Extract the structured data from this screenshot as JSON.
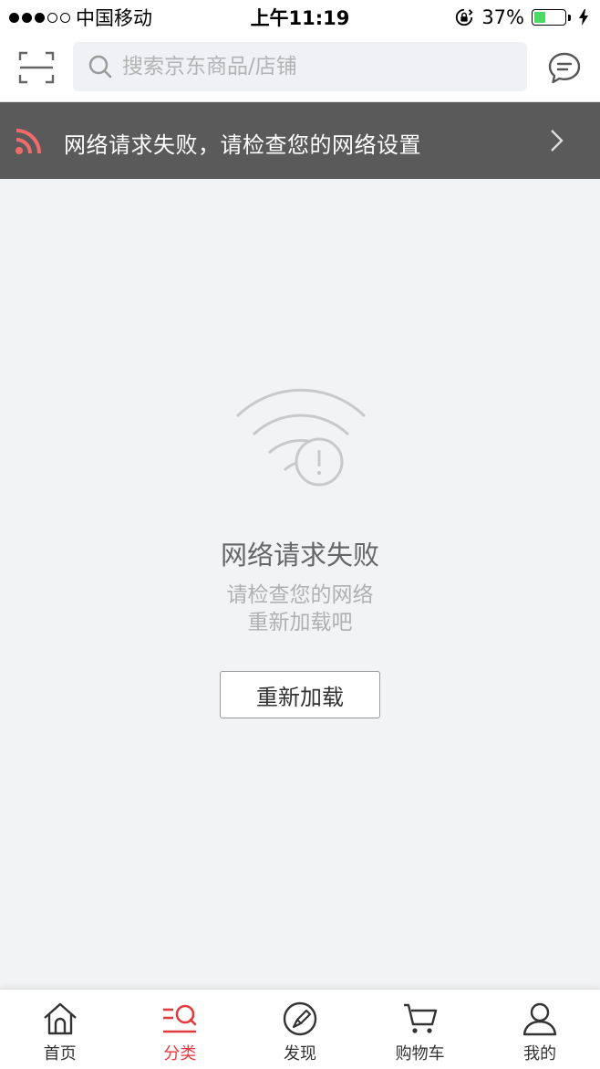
{
  "status_bar": {
    "carrier": "中国移动",
    "time": "上午11:19",
    "battery_percent": "37%",
    "battery_level": 0.37,
    "signal_bars": 3
  },
  "header": {
    "search_placeholder": "搜索京东商品/店铺",
    "scan_icon": "scan-icon",
    "message_icon": "message-icon"
  },
  "banner": {
    "text": "网络请求失败，请检查您的网络设置",
    "icon": "rss-icon"
  },
  "error": {
    "title": "网络请求失败",
    "line1": "请检查您的网络",
    "line2": "重新加载吧",
    "reload_label": "重新加载"
  },
  "tabs": [
    {
      "label": "首页",
      "icon": "home-icon"
    },
    {
      "label": "分类",
      "icon": "category-icon",
      "active": true
    },
    {
      "label": "发现",
      "icon": "compass-icon"
    },
    {
      "label": "购物车",
      "icon": "cart-icon"
    },
    {
      "label": "我的",
      "icon": "user-icon"
    }
  ],
  "colors": {
    "accent": "#e4393c",
    "banner_bg": "#5a5a5a",
    "page_bg": "#f2f3f5",
    "rss": "#f16b6b"
  }
}
